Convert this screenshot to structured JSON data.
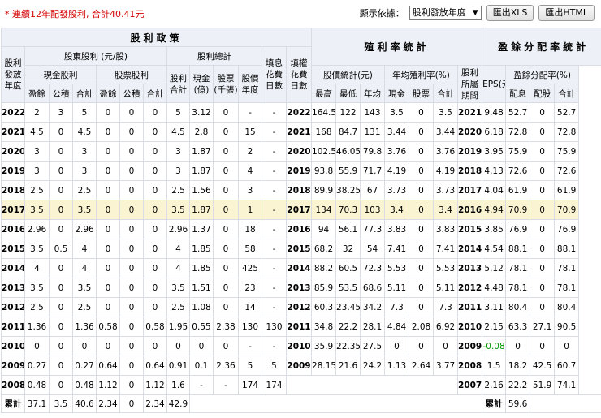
{
  "notice": "* 連續12年配發股利, 合計40.41元",
  "controls": {
    "display_label": "顯示依據：",
    "select_value": "股利發放年度",
    "btn_xls": "匯出XLS",
    "btn_html": "匯出HTML"
  },
  "headers": {
    "sec_dividend": "股利政策",
    "sec_yield": "殖利率統計",
    "sec_payout": "盈餘分配率統計",
    "dividend_year": "股利發放年度",
    "shareholder_div": "股東股利 (元/股)",
    "div_total_group": "股利總計",
    "fill_days": "填息花費日數",
    "fill_rights_days": "填權花費日數",
    "cash_div": "現金股利",
    "stock_div": "股票股利",
    "sub_total": "股利合計",
    "cash_amt": "現金(億)",
    "stock_amt": "股票(千張)",
    "earnings": "盈餘",
    "reserve": "公積",
    "total": "合計",
    "stock_year": "股價年度",
    "price_stats": "股價統計(元)",
    "avg_yield": "年均殖利率(%)",
    "high": "最高",
    "low": "最低",
    "avg": "年均",
    "cash": "現金",
    "stock": "股票",
    "period": "股利所屬期間",
    "eps": "EPS(元)",
    "payout_rate": "盈餘分配率(%)",
    "pay": "配息",
    "allot": "配股"
  },
  "rows": [
    {
      "y": "2022",
      "ce": "2",
      "cr": "3",
      "ct": "5",
      "se": "0",
      "sr": "0",
      "st": "0",
      "tot": "5",
      "camt": "3.12",
      "samt": "0",
      "fd": "-",
      "frd": "-",
      "py": "2022",
      "hi": "164.5",
      "lo": "122",
      "av": "143",
      "yc": "3.5",
      "ys": "0",
      "yt": "3.5",
      "pp": "2021",
      "eps": "9.48",
      "pc": "52.7",
      "ps": "0",
      "pt": "52.7"
    },
    {
      "y": "2021",
      "ce": "4.5",
      "cr": "0",
      "ct": "4.5",
      "se": "0",
      "sr": "0",
      "st": "0",
      "tot": "4.5",
      "camt": "2.8",
      "samt": "0",
      "fd": "15",
      "frd": "-",
      "py": "2021",
      "hi": "168",
      "lo": "84.7",
      "av": "131",
      "yc": "3.44",
      "ys": "0",
      "yt": "3.44",
      "pp": "2020",
      "eps": "6.18",
      "pc": "72.8",
      "ps": "0",
      "pt": "72.8"
    },
    {
      "y": "2020",
      "ce": "3",
      "cr": "0",
      "ct": "3",
      "se": "0",
      "sr": "0",
      "st": "0",
      "tot": "3",
      "camt": "1.87",
      "samt": "0",
      "fd": "2",
      "frd": "-",
      "py": "2020",
      "hi": "102.5",
      "lo": "46.05",
      "av": "79.8",
      "yc": "3.76",
      "ys": "0",
      "yt": "3.76",
      "pp": "2019",
      "eps": "3.95",
      "pc": "75.9",
      "ps": "0",
      "pt": "75.9"
    },
    {
      "y": "2019",
      "ce": "3",
      "cr": "0",
      "ct": "3",
      "se": "0",
      "sr": "0",
      "st": "0",
      "tot": "3",
      "camt": "1.87",
      "samt": "0",
      "fd": "4",
      "frd": "-",
      "py": "2019",
      "hi": "93.8",
      "lo": "55.9",
      "av": "71.7",
      "yc": "4.19",
      "ys": "0",
      "yt": "4.19",
      "pp": "2018",
      "eps": "4.13",
      "pc": "72.6",
      "ps": "0",
      "pt": "72.6"
    },
    {
      "y": "2018",
      "ce": "2.5",
      "cr": "0",
      "ct": "2.5",
      "se": "0",
      "sr": "0",
      "st": "0",
      "tot": "2.5",
      "camt": "1.56",
      "samt": "0",
      "fd": "3",
      "frd": "-",
      "py": "2018",
      "hi": "89.9",
      "lo": "38.25",
      "av": "67",
      "yc": "3.73",
      "ys": "0",
      "yt": "3.73",
      "pp": "2017",
      "eps": "4.04",
      "pc": "61.9",
      "ps": "0",
      "pt": "61.9"
    },
    {
      "y": "2017",
      "ce": "3.5",
      "cr": "0",
      "ct": "3.5",
      "se": "0",
      "sr": "0",
      "st": "0",
      "tot": "3.5",
      "camt": "1.87",
      "samt": "0",
      "fd": "1",
      "frd": "-",
      "py": "2017",
      "hi": "134",
      "lo": "70.3",
      "av": "103",
      "yc": "3.4",
      "ys": "0",
      "yt": "3.4",
      "pp": "2016",
      "eps": "4.94",
      "pc": "70.9",
      "ps": "0",
      "pt": "70.9"
    },
    {
      "y": "2016",
      "ce": "2.96",
      "cr": "0",
      "ct": "2.96",
      "se": "0",
      "sr": "0",
      "st": "0",
      "tot": "2.96",
      "camt": "1.37",
      "samt": "0",
      "fd": "18",
      "frd": "-",
      "py": "2016",
      "hi": "94",
      "lo": "56.1",
      "av": "77.3",
      "yc": "3.83",
      "ys": "0",
      "yt": "3.83",
      "pp": "2015",
      "eps": "3.85",
      "pc": "76.9",
      "ps": "0",
      "pt": "76.9"
    },
    {
      "y": "2015",
      "ce": "3.5",
      "cr": "0.5",
      "ct": "4",
      "se": "0",
      "sr": "0",
      "st": "0",
      "tot": "4",
      "camt": "1.85",
      "samt": "0",
      "fd": "58",
      "frd": "-",
      "py": "2015",
      "hi": "68.2",
      "lo": "32",
      "av": "54",
      "yc": "7.41",
      "ys": "0",
      "yt": "7.41",
      "pp": "2014",
      "eps": "4.54",
      "pc": "88.1",
      "ps": "0",
      "pt": "88.1"
    },
    {
      "y": "2014",
      "ce": "4",
      "cr": "0",
      "ct": "4",
      "se": "0",
      "sr": "0",
      "st": "0",
      "tot": "4",
      "camt": "1.85",
      "samt": "0",
      "fd": "425",
      "frd": "-",
      "py": "2014",
      "hi": "88.2",
      "lo": "60.5",
      "av": "72.3",
      "yc": "5.53",
      "ys": "0",
      "yt": "5.53",
      "pp": "2013",
      "eps": "5.12",
      "pc": "78.1",
      "ps": "0",
      "pt": "78.1"
    },
    {
      "y": "2013",
      "ce": "3.5",
      "cr": "0",
      "ct": "3.5",
      "se": "0",
      "sr": "0",
      "st": "0",
      "tot": "3.5",
      "camt": "1.51",
      "samt": "0",
      "fd": "23",
      "frd": "-",
      "py": "2013",
      "hi": "85.9",
      "lo": "53.5",
      "av": "68.6",
      "yc": "5.11",
      "ys": "0",
      "yt": "5.11",
      "pp": "2012",
      "eps": "4.48",
      "pc": "78.1",
      "ps": "0",
      "pt": "78.1"
    },
    {
      "y": "2012",
      "ce": "2.5",
      "cr": "0",
      "ct": "2.5",
      "se": "0",
      "sr": "0",
      "st": "0",
      "tot": "2.5",
      "camt": "1.08",
      "samt": "0",
      "fd": "14",
      "frd": "-",
      "py": "2012",
      "hi": "60.3",
      "lo": "23.45",
      "av": "34.2",
      "yc": "7.3",
      "ys": "0",
      "yt": "7.3",
      "pp": "2011",
      "eps": "3.11",
      "pc": "80.4",
      "ps": "0",
      "pt": "80.4"
    },
    {
      "y": "2011",
      "ce": "1.36",
      "cr": "0",
      "ct": "1.36",
      "se": "0.58",
      "sr": "0",
      "st": "0.58",
      "tot": "1.95",
      "camt": "0.55",
      "samt": "2.38",
      "fd": "130",
      "frd": "130",
      "py": "2011",
      "hi": "34.8",
      "lo": "22.2",
      "av": "28.1",
      "yc": "4.84",
      "ys": "2.08",
      "yt": "6.92",
      "pp": "2010",
      "eps": "2.15",
      "pc": "63.3",
      "ps": "27.1",
      "pt": "90.5"
    },
    {
      "y": "2010",
      "ce": "0",
      "cr": "0",
      "ct": "0",
      "se": "0",
      "sr": "0",
      "st": "0",
      "tot": "0",
      "camt": "0",
      "samt": "0",
      "fd": "-",
      "frd": "-",
      "py": "2010",
      "hi": "35.9",
      "lo": "22.35",
      "av": "27.5",
      "yc": "0",
      "ys": "0",
      "yt": "0",
      "pp": "2009",
      "eps": "-0.08",
      "pc": "0",
      "ps": "0",
      "pt": "0"
    },
    {
      "y": "2009",
      "ce": "0.27",
      "cr": "0",
      "ct": "0.27",
      "se": "0.64",
      "sr": "0",
      "st": "0.64",
      "tot": "0.91",
      "camt": "0.1",
      "samt": "2.36",
      "fd": "5",
      "frd": "5",
      "py": "2009",
      "hi": "28.15",
      "lo": "21.6",
      "av": "24.2",
      "yc": "1.13",
      "ys": "2.64",
      "yt": "3.77",
      "pp": "2008",
      "eps": "1.5",
      "pc": "18.2",
      "ps": "42.5",
      "pt": "60.7"
    },
    {
      "y": "2008",
      "ce": "0.48",
      "cr": "0",
      "ct": "0.48",
      "se": "1.12",
      "sr": "0",
      "st": "1.12",
      "tot": "1.6",
      "camt": "-",
      "samt": "-",
      "fd": "174",
      "frd": "174",
      "py": "",
      "hi": "",
      "lo": "",
      "av": "",
      "yc": "",
      "ys": "",
      "yt": "",
      "pp": "2007",
      "eps": "2.16",
      "pc": "22.2",
      "ps": "51.9",
      "pt": "74.1"
    }
  ],
  "totals": {
    "label": "累計",
    "ce": "37.1",
    "cr": "3.5",
    "ct": "40.6",
    "se": "2.34",
    "sr": "0",
    "st": "2.34",
    "tot": "42.9",
    "label2": "累計",
    "eps": "59.6"
  },
  "highlight_year": "2017",
  "colors": {
    "header_bg": "#edf1f7",
    "highlight_bg": "#fbf4d2",
    "notice": "#d40000",
    "negative": "#009900"
  }
}
